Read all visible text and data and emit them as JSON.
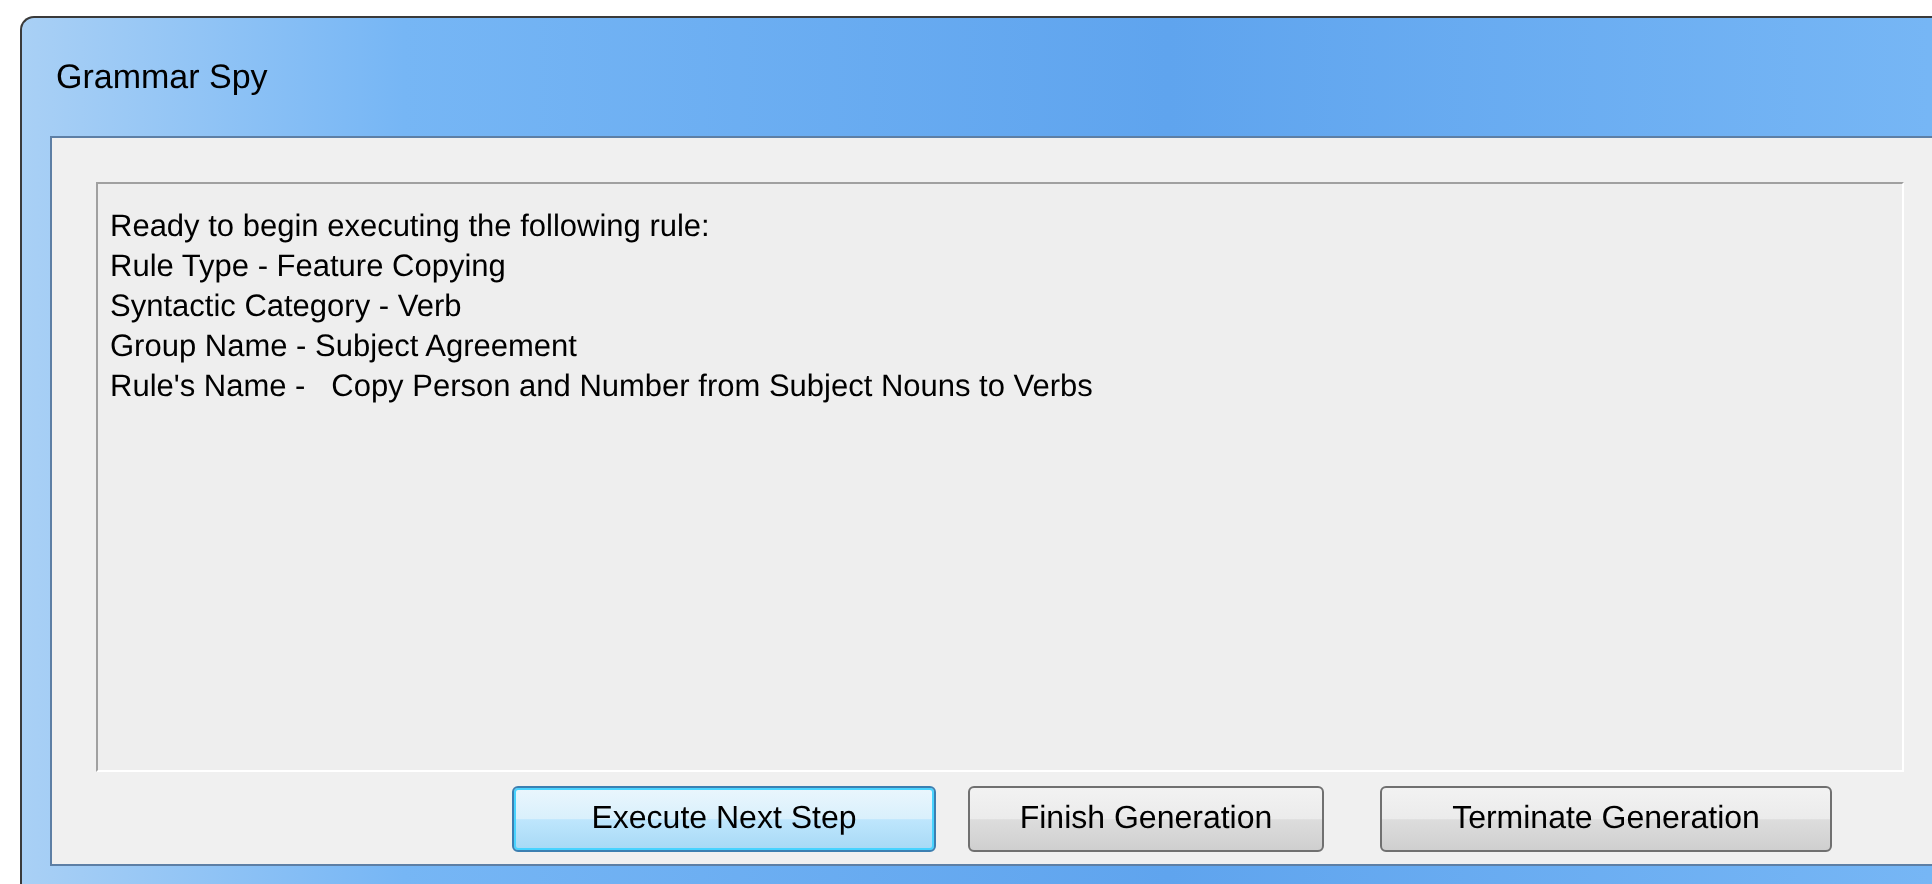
{
  "window": {
    "title": "Grammar Spy"
  },
  "message": {
    "lines": [
      "Ready to begin executing the following rule:",
      "Rule Type - Feature Copying",
      "Syntactic Category - Verb",
      "Group Name - Subject Agreement",
      "Rule's Name -   Copy Person and Number from Subject Nouns to Verbs"
    ]
  },
  "buttons": [
    {
      "label": "Execute Next Step",
      "default": true
    },
    {
      "label": "Finish Generation",
      "default": false
    },
    {
      "label": "Terminate Generation",
      "default": false
    }
  ]
}
